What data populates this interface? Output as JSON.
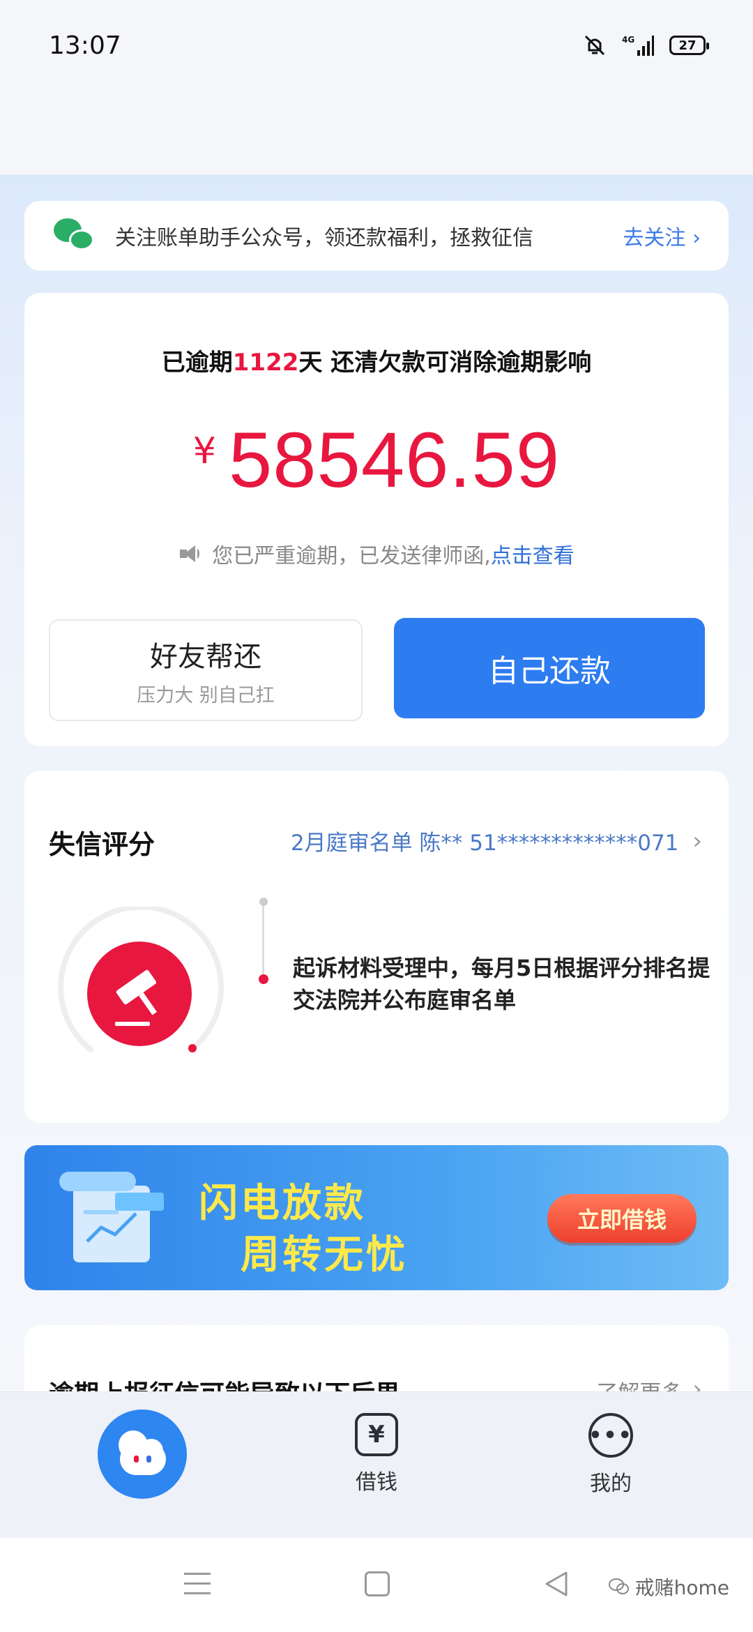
{
  "status_bar": {
    "time": "13:07",
    "network": "4G",
    "battery": "27"
  },
  "follow": {
    "text": "关注账单助手公众号，领还款福利，拯救征信",
    "link": "去关注"
  },
  "debt": {
    "overdue_prefix": "已逾期",
    "overdue_days": "1122",
    "overdue_suffix": "天 还清欠款可消除逾期影响",
    "currency": "¥",
    "amount": "58546.59",
    "notice_text": "您已严重逾期，已发送律师函,",
    "notice_link": "点击查看",
    "friend_button": "好友帮还",
    "friend_sub": "压力大 别自己扛",
    "self_button": "自己还款"
  },
  "credit": {
    "title": "失信评分",
    "list_link": "2月庭审名单 陈** 51*************071",
    "description": "起诉材料受理中，每月5日根据评分排名提交法院并公布庭审名单"
  },
  "banner": {
    "line1": "闪电放款",
    "line2": "周转无忧",
    "button": "立即借钱"
  },
  "consequence": {
    "title": "逾期上报征信可能导致以下后果",
    "link": "了解更多"
  },
  "tabbar": {
    "borrow_label": "借钱",
    "mine_label": "我的",
    "borrow_icon_glyph": "¥",
    "mine_icon_glyph": "•••"
  },
  "watermark": "戒赌home",
  "colors": {
    "accent_red": "#e8173f",
    "primary_blue": "#2d7cf0",
    "wechat_green": "#2aae67",
    "banner_yellow": "#ffe94a"
  }
}
